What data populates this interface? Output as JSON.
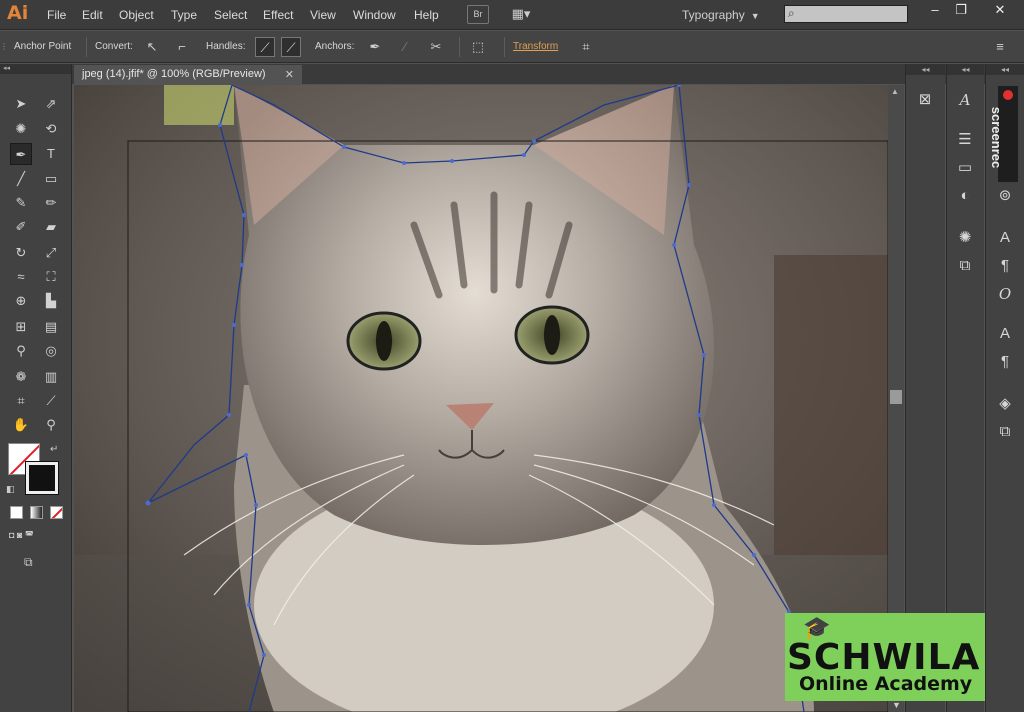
{
  "app": {
    "logo": "Ai",
    "menus": [
      "File",
      "Edit",
      "Object",
      "Type",
      "Select",
      "Effect",
      "View",
      "Window",
      "Help"
    ],
    "bridge_label": "Br",
    "workspace": "Typography",
    "window_buttons": [
      "–",
      "❐",
      "✕"
    ]
  },
  "control_bar": {
    "anchor_point": "Anchor Point",
    "convert": "Convert:",
    "handles": "Handles:",
    "anchors": "Anchors:",
    "transform": "Transform"
  },
  "document": {
    "tab_title": "jpeg (14).jfif* @ 100% (RGB/Preview)",
    "close": "✕"
  },
  "plugin": {
    "label": "screenrec"
  },
  "watermark": {
    "line1": "SCHWILA",
    "line2": "Online Academy"
  },
  "colors": {
    "accent": "#e3843a",
    "transform_link": "#e0a050",
    "path_stroke": "#1f3a8a",
    "watermark_bg": "#7fd05a"
  },
  "icons": {
    "tools": [
      "selection",
      "direct-selection",
      "magic-wand",
      "lasso",
      "pen",
      "type",
      "line",
      "rectangle",
      "paintbrush",
      "pencil",
      "blob-brush",
      "eraser",
      "rotate",
      "scale",
      "warp",
      "free-transform",
      "shape-builder",
      "graph",
      "mesh",
      "gradient",
      "eyedropper",
      "blend",
      "symbol-sprayer",
      "column-graph",
      "artboard",
      "slice",
      "hand",
      "zoom"
    ],
    "dock": [
      "image-icon",
      "character-style-icon",
      "stroke-icon",
      "gradient-panel-icon",
      "transparency-icon",
      "appearance-icon",
      "graphic-style-icon",
      "character-icon",
      "paragraph-icon",
      "opentype-icon",
      "character-styles-icon",
      "paragraph-styles-icon",
      "layers-icon",
      "artboards-icon"
    ]
  }
}
